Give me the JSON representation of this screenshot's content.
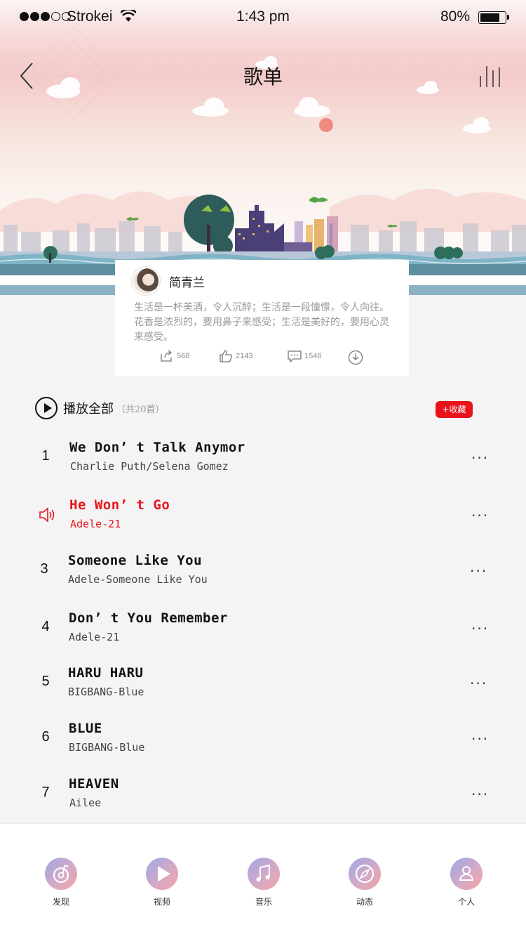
{
  "status": {
    "carrier": "Strokei",
    "time": "1:43 pm",
    "battery": "80%",
    "battery_level": 0.8
  },
  "nav": {
    "title": "歌单"
  },
  "card": {
    "author": "简青兰",
    "description": "生活是一杯美酒，令人沉醉；生活是一段憧憬，令人向往。花香是浓烈的，要用鼻子来感受；生活是美好的，要用心灵来感受。",
    "shares": "568",
    "likes": "2143",
    "comments": "1546"
  },
  "playall": {
    "label": "播放全部",
    "count": "（共20首）",
    "collect": "+收藏"
  },
  "songs": [
    {
      "num": "1",
      "title": "We Don’ t Talk Anymor",
      "artist": "Charlie Puth/Selena Gomez",
      "more": "···"
    },
    {
      "num": "",
      "title": "He Won’ t Go",
      "artist": "Adele-21",
      "more": "···",
      "playing": true
    },
    {
      "num": "3",
      "title": "Someone Like You",
      "artist": "Adele-Someone Like You",
      "more": "···"
    },
    {
      "num": "4",
      "title": "Don’ t You Remember",
      "artist": "Adele-21",
      "more": "···"
    },
    {
      "num": "5",
      "title": "HARU HARU",
      "artist": "BIGBANG-Blue",
      "more": "···"
    },
    {
      "num": "6",
      "title": "BLUE",
      "artist": "BIGBANG-Blue",
      "more": "···"
    },
    {
      "num": "7",
      "title": "HEAVEN",
      "artist": "Ailee",
      "more": "···"
    }
  ],
  "tabs": [
    {
      "label": "发现",
      "icon": "discover-icon"
    },
    {
      "label": "视频",
      "icon": "video-play-icon"
    },
    {
      "label": "音乐",
      "icon": "music-note-icon"
    },
    {
      "label": "动态",
      "icon": "compass-icon"
    },
    {
      "label": "个人",
      "icon": "person-icon"
    }
  ],
  "colors": {
    "accent": "#e8131b",
    "tab_gradient_start": "#9fa7e8",
    "tab_gradient_end": "#f2a4a4"
  }
}
